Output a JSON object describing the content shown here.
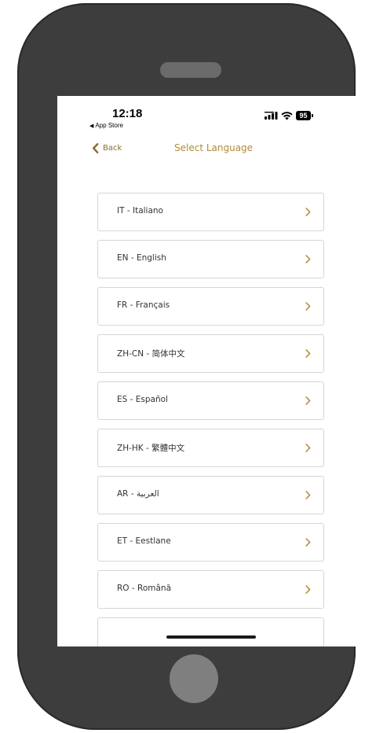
{
  "status_bar": {
    "time": "12:18",
    "back_app": "App Store",
    "battery": "95"
  },
  "nav": {
    "back_label": "Back",
    "title": "Select Language"
  },
  "languages": [
    {
      "label": "IT - Italiano"
    },
    {
      "label": "EN - English"
    },
    {
      "label": "FR - Français"
    },
    {
      "label": "ZH-CN - 简体中文"
    },
    {
      "label": "ES - Español"
    },
    {
      "label": "ZH-HK - 繁體中文"
    },
    {
      "label": "AR - العربية"
    },
    {
      "label": "ET - Eestlane"
    },
    {
      "label": "RO - Română"
    },
    {
      "label": ""
    }
  ],
  "colors": {
    "accent": "#b08b3c",
    "phone_body": "#3d3d3d",
    "item_border": "#d6d6d6"
  },
  "icons": {
    "back": "chevron-left-icon",
    "row": "chevron-right-icon",
    "signal": "signal-icon",
    "wifi": "wifi-icon",
    "battery": "battery-icon"
  }
}
